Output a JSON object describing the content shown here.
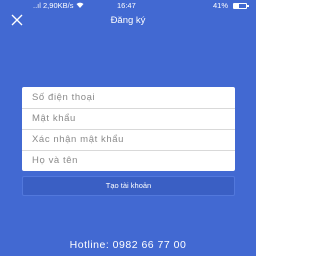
{
  "status_bar": {
    "network": "..ıl",
    "speed": "2,90KB/s",
    "time": "16:47",
    "battery": "41%"
  },
  "header": {
    "title": "Đăng ký"
  },
  "form": {
    "phone_placeholder": "Số điện thoại",
    "password_placeholder": "Mật khẩu",
    "confirm_password_placeholder": "Xác nhận mật khẩu",
    "fullname_placeholder": "Họ và tên"
  },
  "submit_label": "Tạo tài khoản",
  "hotline": "Hotline: 0982 66 77 00",
  "icons": {
    "close": "close-icon",
    "wifi": "wifi-icon",
    "battery": "battery-icon"
  },
  "colors": {
    "background": "#4269d2",
    "button": "#3a5fc4",
    "card": "#ffffff",
    "placeholder": "#8a8a8a"
  }
}
